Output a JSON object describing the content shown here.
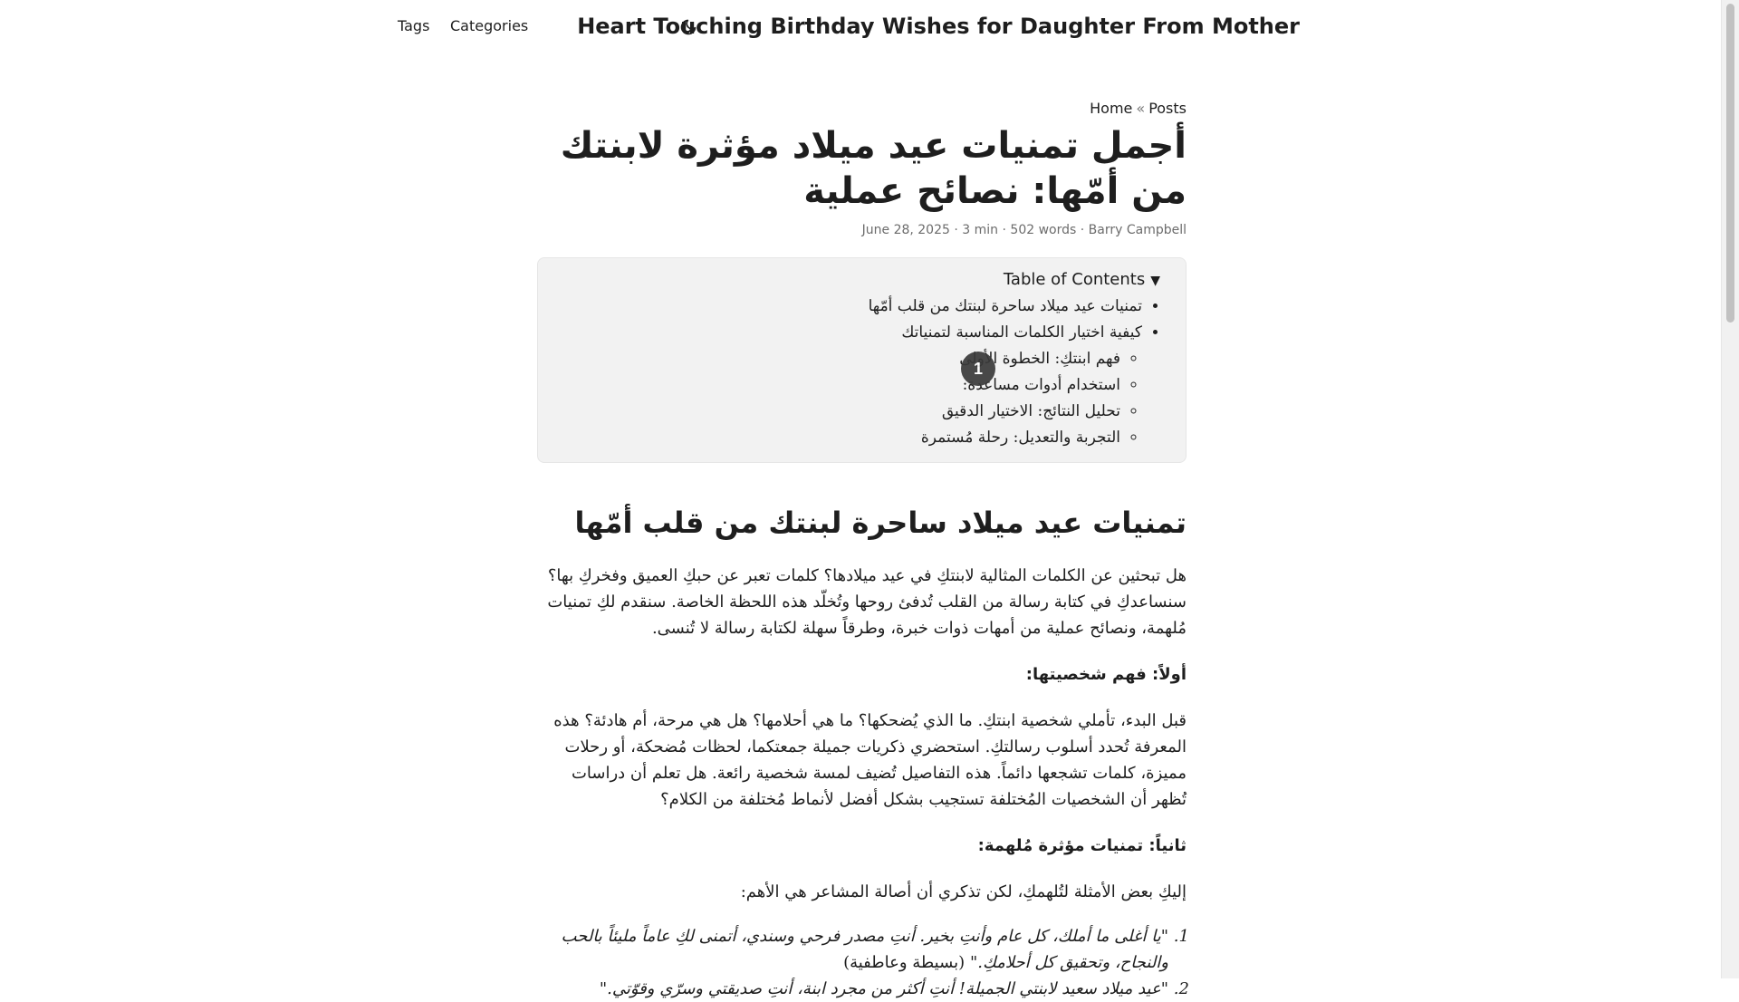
{
  "nav": {
    "tags": "Tags",
    "categories": "Categories"
  },
  "site": {
    "title": "Heart Touching Birthday Wishes for Daughter From Mother",
    "theme_icon": "moon-icon"
  },
  "breadcrumb": {
    "home": "Home",
    "separator": "«",
    "posts": "Posts"
  },
  "post": {
    "title": "أجمل تمنيات عيد ميلاد مؤثرة لابنتك من أمّها: نصائح عملية",
    "date": "June 28, 2025",
    "author": "Barry Campbell",
    "reading_time": "3 min",
    "words": "502 words"
  },
  "toc": {
    "summary": "Table of Contents",
    "items": [
      "تمنيات عيد ميلاد ساحرة لبنتك من قلب أمّها",
      "كيفية اختيار الكلمات المناسبة لتمنياتك"
    ],
    "subitems": [
      "فهم ابنتكِ: الخطوة الأولى",
      "استخدام أدوات مساعدة:",
      "تحليل النتائج: الاختيار الدقيق",
      "التجربة والتعديل: رحلة مُستمرة"
    ]
  },
  "marker": "1",
  "content": {
    "h2": "تمنيات عيد ميلاد ساحرة لبنتك من قلب أمّها",
    "intro": "هل تبحثين عن الكلمات المثالية لابنتكِ في عيد ميلادها؟ كلمات تعبر عن حبكِ العميق وفخركِ بها؟ سنساعدكِ في كتابة رسالة من القلب تُدفئ روحها وتُخلّد هذه اللحظة الخاصة. سنقدم لكِ تمنيات مُلهمة، ونصائح عملية من أمهات ذوات خبرة، وطرقاً سهلة لكتابة رسالة لا تُنسى.",
    "first_heading": "أولاً: فهم شخصيتها:",
    "first_para": "قبل البدء، تأملي شخصية ابنتكِ. ما الذي يُضحكها؟ ما هي أحلامها؟ هل هي مرحة، أم هادئة؟ هذه المعرفة تُحدد أسلوب رسالتكِ. استحضري ذكريات جميلة جمعتكما، لحظات مُضحكة، أو رحلات مميزة، كلمات تشجعها دائماً. هذه التفاصيل تُضيف لمسة شخصية رائعة. هل تعلم أن دراسات تُظهر أن الشخصيات المُختلفة تستجيب بشكل أفضل لأنماط مُختلفة من الكلام؟",
    "second_heading": "ثانياً: تمنيات مؤثرة مُلهمة:",
    "second_para": "إليكِ بعض الأمثلة لتُلهمكِ، لكن تذكري أن أصالة المشاعر هي الأهم:",
    "examples": [
      {
        "quote": "\"يا أغلى ما أملك، كل عام وأنتِ بخير. أنتِ مصدر فرحي وسندي، أتمنى لكِ عاماً مليئاً بالحب والنجاح، وتحقيق كل أحلامكِ.\"",
        "note": "(بسيطة وعاطفية)"
      },
      {
        "quote": "\"عيد ميلاد سعيد لابنتي الجميلة! أنتِ أكثر من مجرد ابنة، أنتِ صديقتي وسرّي وقوّتي.\"",
        "note": ""
      }
    ]
  }
}
